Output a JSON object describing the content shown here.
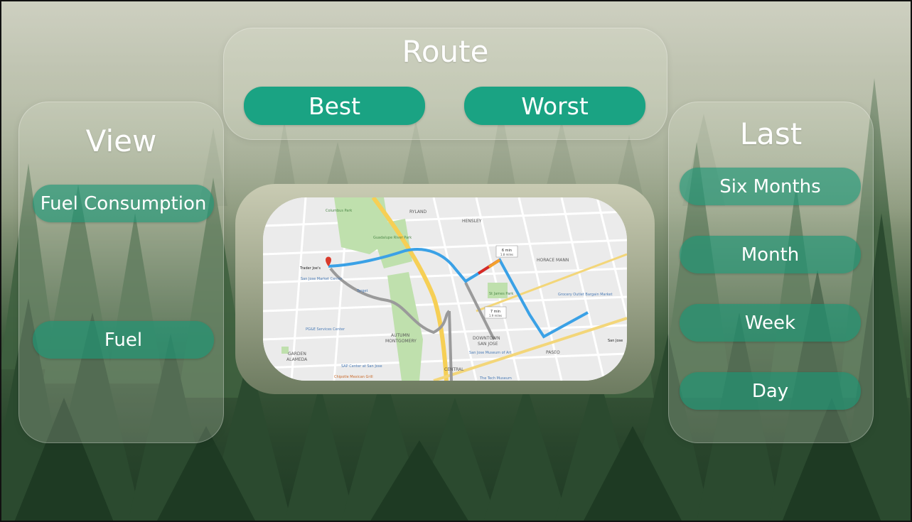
{
  "colors": {
    "button_fill": "#1aa383",
    "panel_glass": "rgba(226,230,215,0.22)",
    "route_blue": "#3aa1e6",
    "forest_dark": "#1f3a24"
  },
  "route": {
    "title": "Route",
    "buttons": [
      {
        "label": "Best"
      },
      {
        "label": "Worst"
      }
    ]
  },
  "view": {
    "title": "View",
    "buttons": [
      {
        "label": "Fuel Consumption"
      },
      {
        "label": "Fuel"
      }
    ]
  },
  "last": {
    "title": "Last",
    "buttons": [
      {
        "label": "Six Months"
      },
      {
        "label": "Month"
      },
      {
        "label": "Week"
      },
      {
        "label": "Day"
      }
    ]
  },
  "map": {
    "labels": {
      "ryland": "RYLAND",
      "hensley": "HENSLEY",
      "horace_mann": "HORACE MANN",
      "autumn": "AUTUMN",
      "montgomery": "MONTGOMERY",
      "garden": "GARDEN",
      "alameda": "ALAMEDA",
      "downtown": "DOWNTOWN",
      "san_jose_district": "SAN JOSE",
      "central": "CENTRAL",
      "paseo": "PASEO",
      "trader_joes": "Trader Joe's",
      "sj_market_center": "San Jose Market Center",
      "target": "Target",
      "pge": "PG&E Services Center",
      "sap_center": "SAP Center at San Jose",
      "chipotle": "Chipotle Mexican Grill",
      "museum_art": "San Jose Museum of Art",
      "tech_museum": "The Tech Museum",
      "st_james": "St James Park",
      "grocery": "Grocery Outlet Bargain Market",
      "san_jose_city": "San Jose",
      "guadalupe_park": "Guadalupe River Park",
      "columbus": "Columbus Park"
    },
    "callouts": [
      {
        "time": "6 min",
        "dist": "1.8 miles"
      },
      {
        "time": "7 min",
        "dist": "1.9 miles"
      }
    ]
  }
}
